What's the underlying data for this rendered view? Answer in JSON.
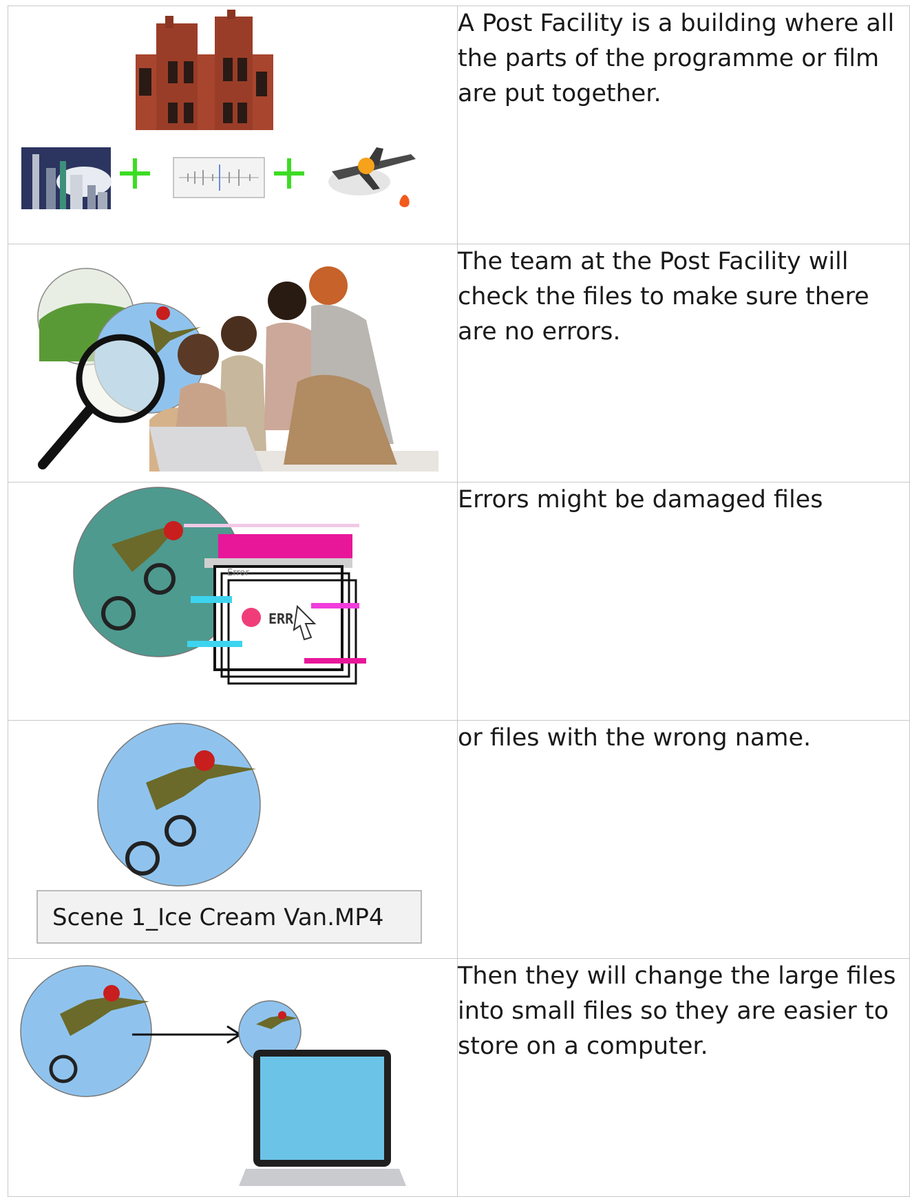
{
  "rows": [
    {
      "text": "A Post Facility is a building where all the parts of the programme or film are put together."
    },
    {
      "text": "The team at the Post Facility will check the files to make sure there are no errors."
    },
    {
      "text": "Errors might be damaged files"
    },
    {
      "text": "or files with the wrong name.",
      "file_name": "Scene 1_Ice Cream Van.MP4"
    },
    {
      "text": "Then they will change the large files into small files so they are easier to store on a computer."
    }
  ],
  "error_dialog": {
    "title": "Error",
    "code": "ERR"
  },
  "colors": {
    "plus": "#3ddc24",
    "sky": "#8fc3ee",
    "screen": "#6cc3e8",
    "brick": "#a8452e",
    "teal": "#4e9a8f"
  }
}
